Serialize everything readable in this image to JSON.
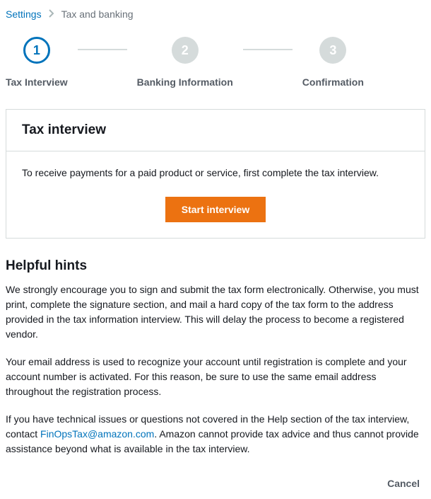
{
  "breadcrumb": {
    "root": "Settings",
    "current": "Tax and banking"
  },
  "stepper": {
    "steps": [
      {
        "num": "1",
        "label": "Tax Interview"
      },
      {
        "num": "2",
        "label": "Banking Information"
      },
      {
        "num": "3",
        "label": "Confirmation"
      }
    ]
  },
  "panel": {
    "title": "Tax interview",
    "body": "To receive payments for a paid product or service, first complete the tax interview.",
    "button": "Start interview"
  },
  "hints": {
    "title": "Helpful hints",
    "p1": "We strongly encourage you to sign and submit the tax form electronically. Otherwise, you must print, complete the signature section, and mail a hard copy of the tax form to the address provided in the tax information interview. This will delay the process to become a registered vendor.",
    "p2": "Your email address is used to recognize your account until registration is complete and your account number is activated. For this reason, be sure to use the same email address throughout the registration process.",
    "p3a": "If you have technical issues or questions not covered in the Help section of the tax interview, contact ",
    "email": "FinOpsTax@amazon.com",
    "p3b": ". Amazon cannot provide tax advice and thus cannot provide assistance beyond what is available in the tax interview."
  },
  "footer": {
    "cancel": "Cancel"
  }
}
